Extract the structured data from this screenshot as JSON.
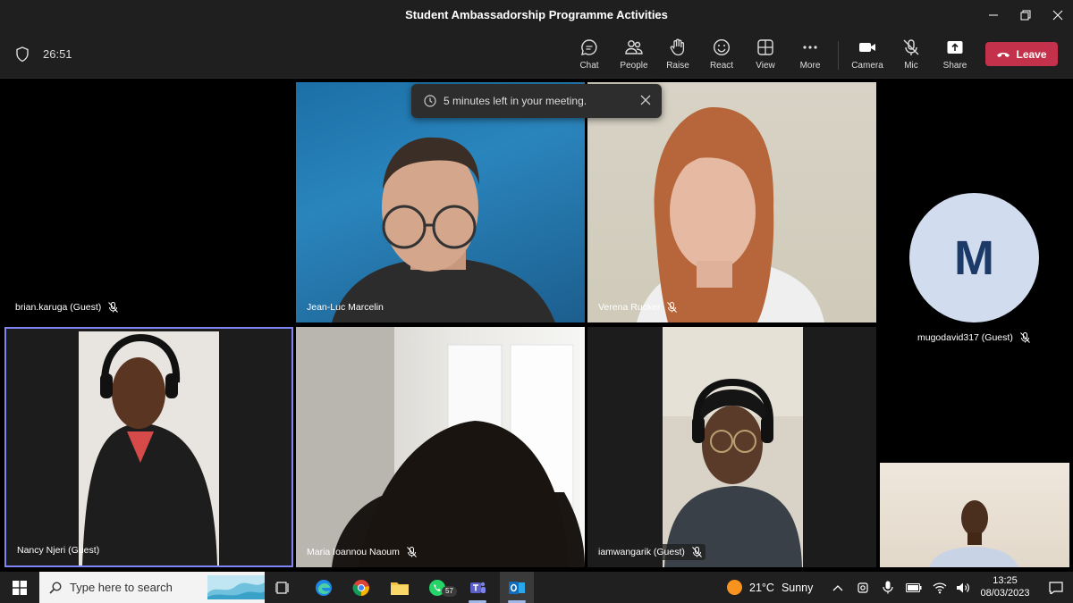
{
  "window": {
    "title": "Student Ambassadorship Programme Activities"
  },
  "meeting": {
    "elapsed": "26:51"
  },
  "toolbar": {
    "chat": "Chat",
    "people": "People",
    "raise": "Raise",
    "react": "React",
    "view": "View",
    "more": "More",
    "camera": "Camera",
    "mic": "Mic",
    "share": "Share",
    "leave": "Leave"
  },
  "toast": {
    "message": "5 minutes left in your meeting."
  },
  "participants": {
    "p1": "brian.karuga (Guest)",
    "p2": "Jean-Luc Marcelin",
    "p3": "Verena Rucker",
    "p4": "Nancy Njeri (Guest)",
    "p5": "Maria Ioannou Naoum",
    "p6": "iamwangarik (Guest)",
    "p7": "mugodavid317 (Guest)",
    "p7_initial": "M"
  },
  "taskbar": {
    "search_placeholder": "Type here to search",
    "whatsapp_badge": "57",
    "weather_temp": "21°C",
    "weather_text": "Sunny",
    "time": "13:25",
    "date": "08/03/2023"
  },
  "colors": {
    "leave": "#c4314b",
    "active_border": "#7f85f5",
    "avatar_bg": "#d1dcef",
    "avatar_fg": "#1c3a68"
  }
}
